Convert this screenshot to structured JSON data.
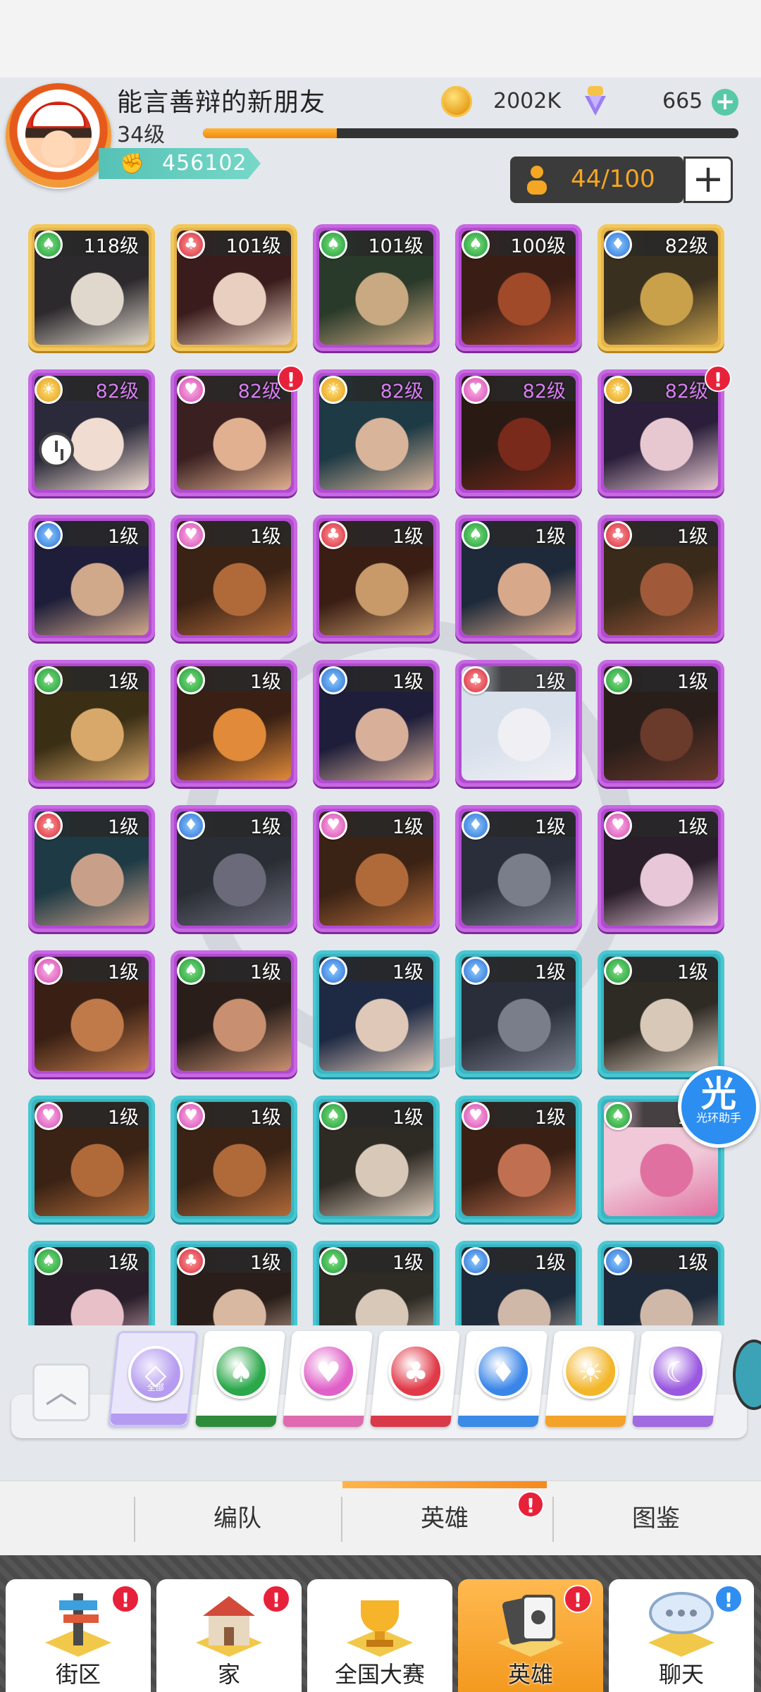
{
  "profile": {
    "username": "能言善辩的新朋友",
    "level": "34级",
    "level_progress": 0.25,
    "power": "456102",
    "coins": "2002K",
    "gems": "665",
    "capacity": "44/100"
  },
  "heroes": [
    {
      "level": "118级",
      "suit": "spade",
      "frame": "gold"
    },
    {
      "level": "101级",
      "suit": "club",
      "frame": "gold"
    },
    {
      "level": "101级",
      "suit": "spade",
      "frame": "purple"
    },
    {
      "level": "100级",
      "suit": "spade",
      "frame": "purple"
    },
    {
      "level": "82级",
      "suit": "diamond",
      "frame": "gold"
    },
    {
      "level": "82级",
      "suit": "sun",
      "frame": "purple",
      "clock": true
    },
    {
      "level": "82级",
      "suit": "heart",
      "frame": "purple",
      "alert": true
    },
    {
      "level": "82级",
      "suit": "sun",
      "frame": "purple"
    },
    {
      "level": "82级",
      "suit": "heart",
      "frame": "purple"
    },
    {
      "level": "82级",
      "suit": "sun",
      "frame": "purple",
      "alert": true
    },
    {
      "level": "1级",
      "suit": "diamond",
      "frame": "purple"
    },
    {
      "level": "1级",
      "suit": "heart",
      "frame": "purple"
    },
    {
      "level": "1级",
      "suit": "club",
      "frame": "purple"
    },
    {
      "level": "1级",
      "suit": "spade",
      "frame": "purple"
    },
    {
      "level": "1级",
      "suit": "club",
      "frame": "purple"
    },
    {
      "level": "1级",
      "suit": "spade",
      "frame": "purple"
    },
    {
      "level": "1级",
      "suit": "spade",
      "frame": "purple"
    },
    {
      "level": "1级",
      "suit": "diamond",
      "frame": "purple"
    },
    {
      "level": "1级",
      "suit": "club",
      "frame": "purple"
    },
    {
      "level": "1级",
      "suit": "spade",
      "frame": "purple"
    },
    {
      "level": "1级",
      "suit": "club",
      "frame": "purple"
    },
    {
      "level": "1级",
      "suit": "diamond",
      "frame": "purple"
    },
    {
      "level": "1级",
      "suit": "heart",
      "frame": "purple"
    },
    {
      "level": "1级",
      "suit": "diamond",
      "frame": "purple"
    },
    {
      "level": "1级",
      "suit": "heart",
      "frame": "purple"
    },
    {
      "level": "1级",
      "suit": "heart",
      "frame": "purple"
    },
    {
      "level": "1级",
      "suit": "spade",
      "frame": "purple"
    },
    {
      "level": "1级",
      "suit": "diamond",
      "frame": "teal"
    },
    {
      "level": "1级",
      "suit": "diamond",
      "frame": "teal"
    },
    {
      "level": "1级",
      "suit": "spade",
      "frame": "teal"
    },
    {
      "level": "1级",
      "suit": "heart",
      "frame": "teal"
    },
    {
      "level": "1级",
      "suit": "heart",
      "frame": "teal"
    },
    {
      "level": "1级",
      "suit": "spade",
      "frame": "teal"
    },
    {
      "level": "1级",
      "suit": "heart",
      "frame": "teal"
    },
    {
      "level": "1级",
      "suit": "spade",
      "frame": "teal"
    },
    {
      "level": "1级",
      "suit": "spade",
      "frame": "teal"
    },
    {
      "level": "1级",
      "suit": "club",
      "frame": "teal"
    },
    {
      "level": "1级",
      "suit": "spade",
      "frame": "teal"
    },
    {
      "level": "1级",
      "suit": "diamond",
      "frame": "teal"
    },
    {
      "level": "1级",
      "suit": "diamond",
      "frame": "teal"
    }
  ],
  "assistant": {
    "icon_text": "光",
    "label": "光环助手"
  },
  "filters": [
    {
      "name": "all",
      "label": "全部",
      "color": "#b69cf0",
      "stripe": "#b69cf0"
    },
    {
      "name": "spade",
      "color": "#2aa84a",
      "stripe": "#2e8b3a"
    },
    {
      "name": "heart",
      "color": "#e060c8",
      "stripe": "#e06ab0"
    },
    {
      "name": "club",
      "color": "#e03a48",
      "stripe": "#d83a4a"
    },
    {
      "name": "diamond",
      "color": "#3a86e8",
      "stripe": "#3a8ae6"
    },
    {
      "name": "sun",
      "color": "#f3b62a",
      "stripe": "#f3a32a"
    },
    {
      "name": "moon",
      "color": "#9a58e0",
      "stripe": "#a06ae0"
    }
  ],
  "subtabs": [
    "编队",
    "英雄",
    "图鉴"
  ],
  "nav": [
    {
      "label": "街区",
      "badge": "!",
      "badge_color": "red"
    },
    {
      "label": "家",
      "badge": "!",
      "badge_color": "red"
    },
    {
      "label": "全国大赛",
      "badge": "",
      "badge_color": ""
    },
    {
      "label": "英雄",
      "badge": "!",
      "badge_color": "red"
    },
    {
      "label": "聊天",
      "badge": "!",
      "badge_color": "blue"
    }
  ]
}
